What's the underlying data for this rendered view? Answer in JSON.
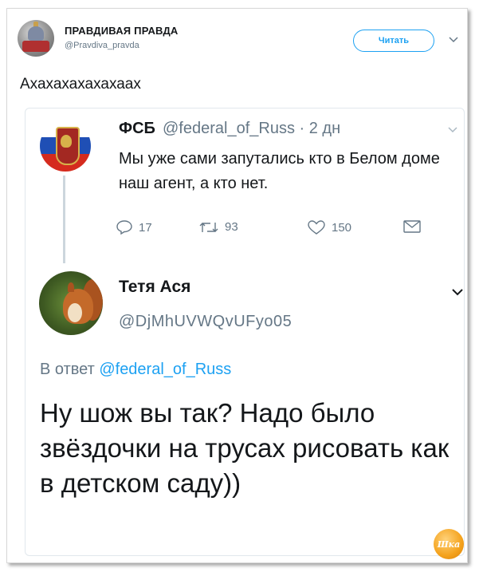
{
  "account": {
    "name": "ПРАВДИВАЯ ПРАВДА",
    "handle": "@Pravdiva_pravda",
    "follow_label": "Читать"
  },
  "tweet": {
    "text": "Ахахахахахахаах"
  },
  "quoted": {
    "name": "ФСБ",
    "meta": "@federal_of_Russ · 2 дн",
    "text": "Мы уже сами запутались кто в Белом доме наш агент, а кто нет.",
    "replies": "17",
    "retweets": "93",
    "likes": "150"
  },
  "reply": {
    "name": "Тетя Ася",
    "handle": "@DjMhUVWQvUFyo05",
    "reply_prefix": "В ответ",
    "reply_mention": "@federal_of_Russ",
    "text": "Ну шож вы так? Надо было звёздочки на трусах рисовать как в детском саду))"
  },
  "watermark": {
    "text": "Шка"
  },
  "colors": {
    "accent": "#1da1f2",
    "muted": "#657786",
    "text": "#14171a"
  },
  "icons": [
    "chevron-down-icon",
    "reply-icon",
    "retweet-icon",
    "like-icon",
    "message-icon"
  ]
}
